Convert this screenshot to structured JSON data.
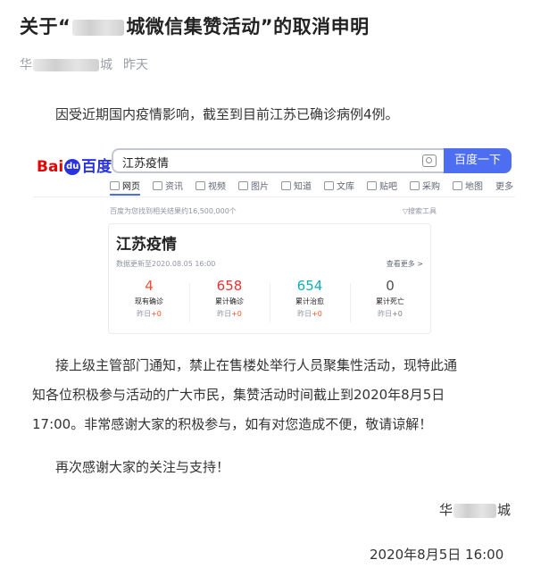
{
  "article": {
    "title_before": "关于“",
    "title_after": "城微信集赞活动”的取消申明",
    "author_prefix": "华",
    "author_suffix": "城",
    "publish_time": "昨天",
    "paragraph1": "因受近期国内疫情影响，截至到目前江苏已确诊病例4例。",
    "paragraph2_lines": [
      "接上级主管部门通知，禁止在售楼处举行人员聚集性活动，现特此通",
      "知各位积极参与活动的广大市民，集赞活动时间截止到2020年8月5日",
      "17:00。非常感谢大家的积极参与，如有对您造成不便，敬请谅解！"
    ],
    "paragraph3": "再次感谢大家的关注与支持！",
    "signature_prefix": "华",
    "signature_suffix": "城",
    "sign_date": "2020年8月5日  16:00"
  },
  "baidu": {
    "logo_left": "Bai",
    "logo_paw": "du",
    "logo_right": "百度",
    "query": "江苏疫情",
    "search_button": "百度一下",
    "tabs": [
      "网页",
      "资讯",
      "视频",
      "图片",
      "知道",
      "文库",
      "贴吧",
      "采购",
      "地图",
      "更多"
    ],
    "result_count": "百度为您找到相关结果约16,500,000个",
    "search_tools": "搜索工具",
    "card_title": "江苏疫情",
    "updated": "数据更新至2020.08.05 16:00",
    "see_more": "查看更多 >",
    "stats": [
      {
        "value": "4",
        "label": "现有确诊",
        "delta_prefix": "昨日",
        "delta": "+0",
        "color": "#f74c31"
      },
      {
        "value": "658",
        "label": "累计确诊",
        "delta_prefix": "昨日",
        "delta": "+0",
        "color": "#e83132"
      },
      {
        "value": "654",
        "label": "累计治愈",
        "delta_prefix": "昨日",
        "delta": "+0",
        "color": "#10aeb5"
      },
      {
        "value": "0",
        "label": "累计死亡",
        "delta_prefix": "昨日",
        "delta": "+0",
        "color": "#4d5054"
      }
    ]
  }
}
